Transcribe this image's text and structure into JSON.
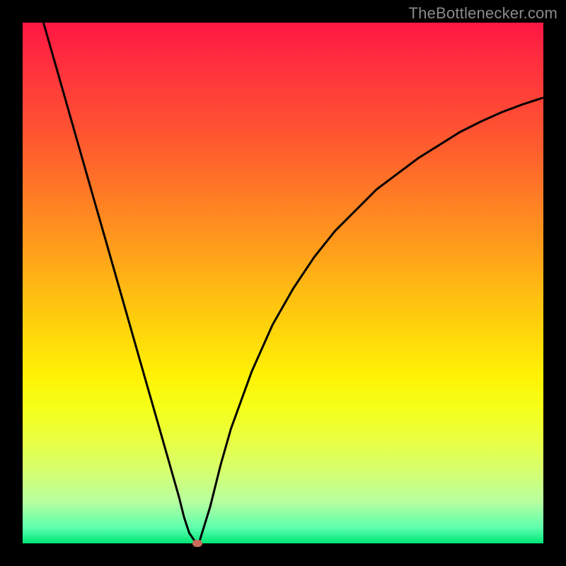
{
  "watermark": "TheBottlenecker.com",
  "colors": {
    "frame": "#000000",
    "curve": "#000000",
    "marker": "#c96a5b",
    "gradient_top": "#ff1744",
    "gradient_bottom": "#00e676"
  },
  "layout": {
    "image_size": 800,
    "plot_offset": 32,
    "plot_size": 736
  },
  "chart_data": {
    "type": "line",
    "title": "",
    "xlabel": "",
    "ylabel": "",
    "xlim": [
      0,
      100
    ],
    "ylim": [
      0,
      100
    ],
    "x": [
      4,
      6,
      8,
      10,
      12,
      14,
      16,
      18,
      20,
      22,
      24,
      26,
      28,
      30,
      31,
      32,
      33,
      33.5,
      34,
      36,
      38,
      40,
      44,
      48,
      52,
      56,
      60,
      64,
      68,
      72,
      76,
      80,
      84,
      88,
      92,
      96,
      100
    ],
    "values": [
      100,
      93,
      86,
      79,
      72,
      65,
      58,
      51,
      44,
      37,
      30,
      23,
      16,
      9,
      5,
      2,
      0.5,
      0,
      0.5,
      7,
      15,
      22,
      33,
      42,
      49,
      55,
      60,
      64,
      68,
      71,
      74,
      76.5,
      79,
      81,
      82.8,
      84.3,
      85.6
    ],
    "annotations": [
      {
        "name": "optimal",
        "x": 33.5,
        "y": 0
      }
    ]
  }
}
